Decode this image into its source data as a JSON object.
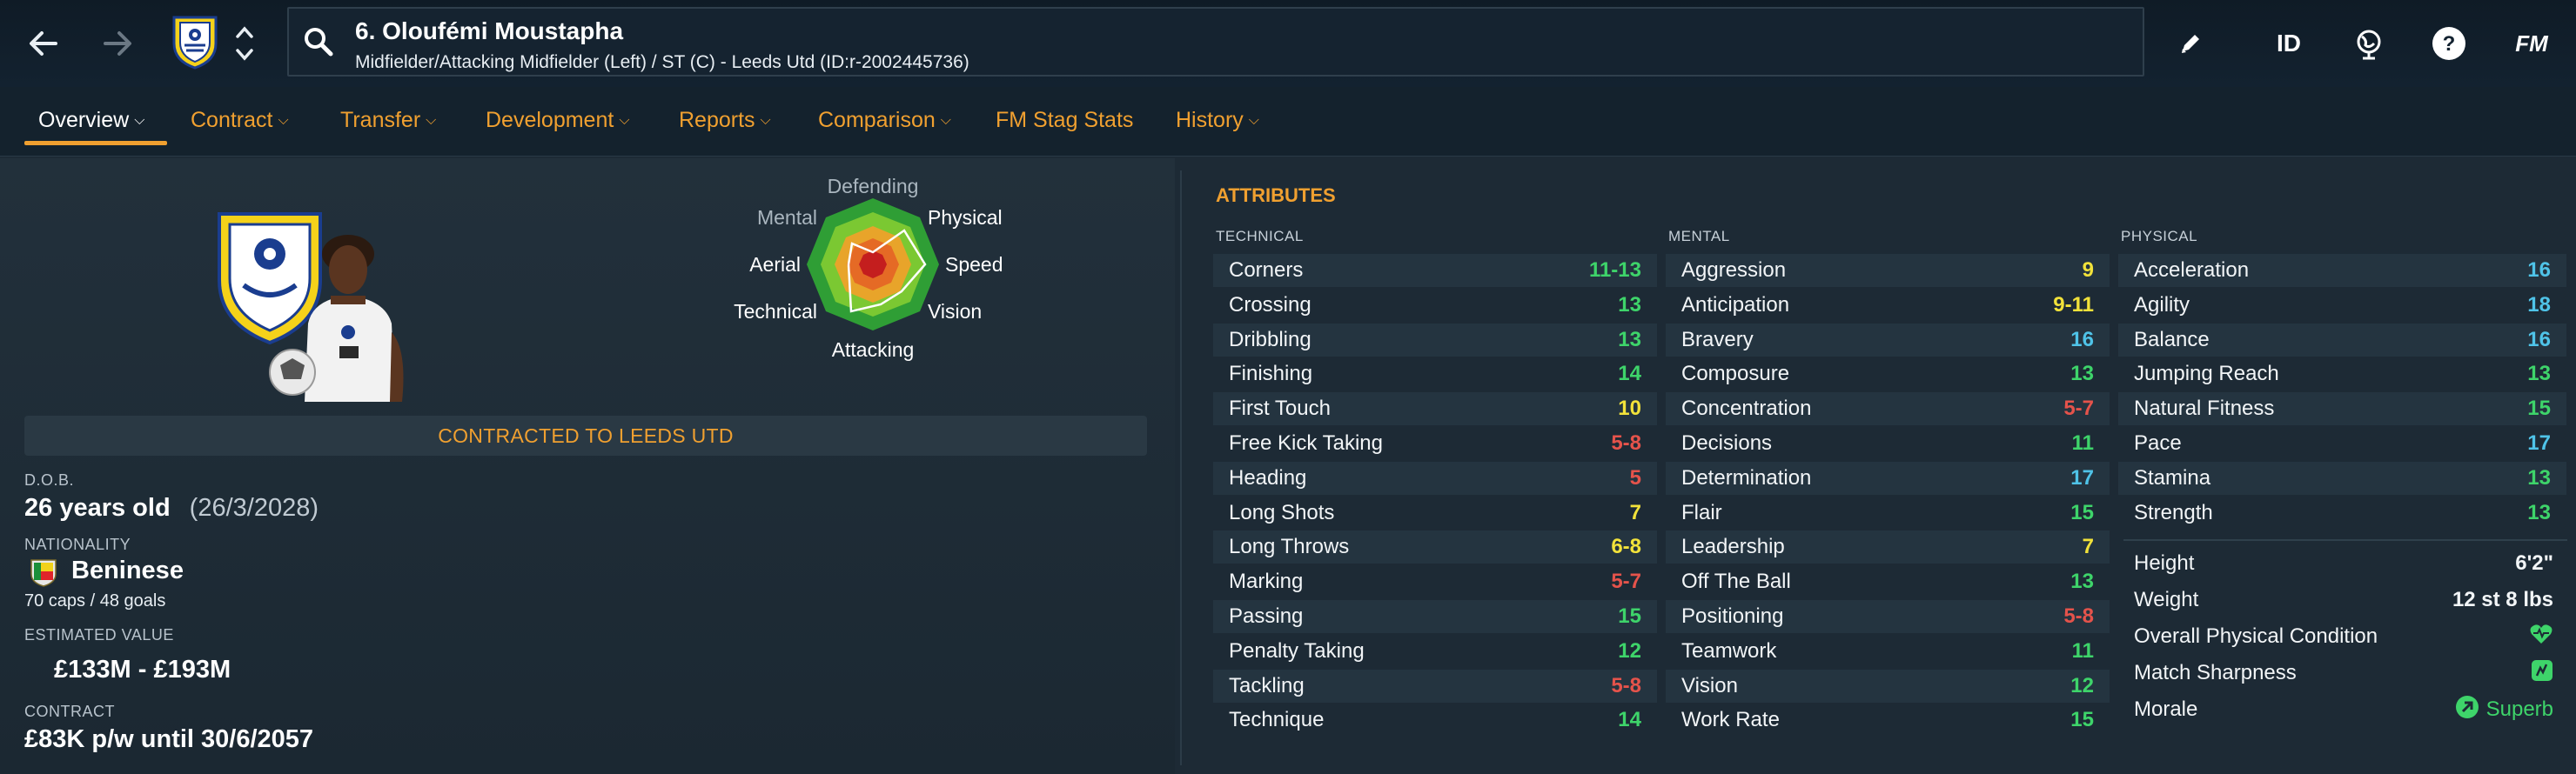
{
  "header": {
    "player_title": "6. Oloufémi Moustapha",
    "player_subtitle": "Midfielder/Attacking Midfielder (Left) / ST (C) - Leeds Utd (ID:r-2002445736)",
    "id_label": "ID",
    "fm_label": "FM",
    "help_label": "?"
  },
  "tabs": [
    {
      "label": "Overview",
      "has_dropdown": true
    },
    {
      "label": "Contract",
      "has_dropdown": true
    },
    {
      "label": "Transfer",
      "has_dropdown": true
    },
    {
      "label": "Development",
      "has_dropdown": true
    },
    {
      "label": "Reports",
      "has_dropdown": true
    },
    {
      "label": "Comparison",
      "has_dropdown": true
    },
    {
      "label": "FM Stag Stats",
      "has_dropdown": false
    },
    {
      "label": "History",
      "has_dropdown": true
    }
  ],
  "radar": {
    "labels": {
      "defending": "Defending",
      "physical": "Physical",
      "speed": "Speed",
      "vision": "Vision",
      "attacking": "Attacking",
      "technical": "Technical",
      "aerial": "Aerial",
      "mental": "Mental"
    }
  },
  "profile": {
    "contract_banner": "CONTRACTED TO LEEDS UTD",
    "dob_label": "D.O.B.",
    "age": "26 years old",
    "dob": "(26/3/2028)",
    "nationality_label": "NATIONALITY",
    "nationality": "Beninese",
    "caps": "70 caps / 48 goals",
    "value_label": "ESTIMATED VALUE",
    "value": "£133M - £193M",
    "contract_label": "CONTRACT",
    "contract": "£83K p/w until 30/6/2057"
  },
  "attributes": {
    "title": "ATTRIBUTES",
    "technical_header": "TECHNICAL",
    "mental_header": "MENTAL",
    "physical_header": "PHYSICAL",
    "technical": [
      {
        "name": "Corners",
        "value": "11-13",
        "color": "#3ed46a"
      },
      {
        "name": "Crossing",
        "value": "13",
        "color": "#3ed46a"
      },
      {
        "name": "Dribbling",
        "value": "13",
        "color": "#3ed46a"
      },
      {
        "name": "Finishing",
        "value": "14",
        "color": "#3ed46a"
      },
      {
        "name": "First Touch",
        "value": "10",
        "color": "#f2e23a"
      },
      {
        "name": "Free Kick Taking",
        "value": "5-8",
        "color": "#e5534b"
      },
      {
        "name": "Heading",
        "value": "5",
        "color": "#e5534b"
      },
      {
        "name": "Long Shots",
        "value": "7",
        "color": "#f2e23a"
      },
      {
        "name": "Long Throws",
        "value": "6-8",
        "color": "#f2e23a"
      },
      {
        "name": "Marking",
        "value": "5-7",
        "color": "#e5534b"
      },
      {
        "name": "Passing",
        "value": "15",
        "color": "#3ed46a"
      },
      {
        "name": "Penalty Taking",
        "value": "12",
        "color": "#3ed46a"
      },
      {
        "name": "Tackling",
        "value": "5-8",
        "color": "#e5534b"
      },
      {
        "name": "Technique",
        "value": "14",
        "color": "#3ed46a"
      }
    ],
    "mental": [
      {
        "name": "Aggression",
        "value": "9",
        "color": "#f2e23a"
      },
      {
        "name": "Anticipation",
        "value": "9-11",
        "color": "#f2e23a"
      },
      {
        "name": "Bravery",
        "value": "16",
        "color": "#4fc3e8"
      },
      {
        "name": "Composure",
        "value": "13",
        "color": "#3ed46a"
      },
      {
        "name": "Concentration",
        "value": "5-7",
        "color": "#e5534b"
      },
      {
        "name": "Decisions",
        "value": "11",
        "color": "#3ed46a"
      },
      {
        "name": "Determination",
        "value": "17",
        "color": "#4fc3e8"
      },
      {
        "name": "Flair",
        "value": "15",
        "color": "#3ed46a"
      },
      {
        "name": "Leadership",
        "value": "7",
        "color": "#f2e23a"
      },
      {
        "name": "Off The Ball",
        "value": "13",
        "color": "#3ed46a"
      },
      {
        "name": "Positioning",
        "value": "5-8",
        "color": "#e5534b"
      },
      {
        "name": "Teamwork",
        "value": "11",
        "color": "#3ed46a"
      },
      {
        "name": "Vision",
        "value": "12",
        "color": "#3ed46a"
      },
      {
        "name": "Work Rate",
        "value": "15",
        "color": "#3ed46a"
      }
    ],
    "physical": [
      {
        "name": "Acceleration",
        "value": "16",
        "color": "#4fc3e8"
      },
      {
        "name": "Agility",
        "value": "18",
        "color": "#4fc3e8"
      },
      {
        "name": "Balance",
        "value": "16",
        "color": "#4fc3e8"
      },
      {
        "name": "Jumping Reach",
        "value": "13",
        "color": "#3ed46a"
      },
      {
        "name": "Natural Fitness",
        "value": "15",
        "color": "#3ed46a"
      },
      {
        "name": "Pace",
        "value": "17",
        "color": "#4fc3e8"
      },
      {
        "name": "Stamina",
        "value": "13",
        "color": "#3ed46a"
      },
      {
        "name": "Strength",
        "value": "13",
        "color": "#3ed46a"
      }
    ],
    "physical_info": {
      "height_label": "Height",
      "height": "6'2\"",
      "weight_label": "Weight",
      "weight": "12 st 8 lbs",
      "condition_label": "Overall Physical Condition",
      "sharpness_label": "Match Sharpness",
      "morale_label": "Morale",
      "morale": "Superb"
    }
  },
  "colors": {
    "accent": "#f0a030",
    "background": "#1d2a35",
    "green": "#3ed46a",
    "yellow": "#f2e23a",
    "red": "#e5534b",
    "blue": "#4fc3e8"
  }
}
